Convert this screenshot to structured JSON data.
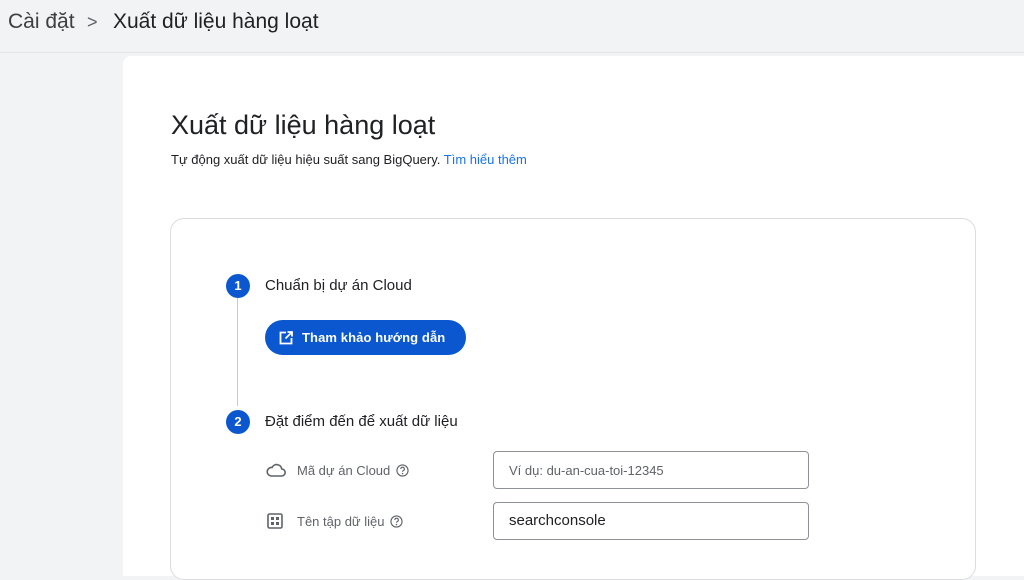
{
  "breadcrumb": {
    "root": "Cài đặt",
    "separator": ">",
    "current": "Xuất dữ liệu hàng loạt"
  },
  "page": {
    "title": "Xuất dữ liệu hàng loạt",
    "description": "Tự động xuất dữ liệu hiệu suất sang BigQuery.",
    "learn_more": "Tìm hiểu thêm"
  },
  "steps": [
    {
      "number": "1",
      "title": "Chuẩn bị dự án Cloud",
      "button_label": "Tham khảo hướng dẫn",
      "button_icon": "open-in-new-icon"
    },
    {
      "number": "2",
      "title": "Đặt điểm đến để xuất dữ liệu",
      "fields": [
        {
          "label": "Mã dự án Cloud",
          "icon": "cloud-icon",
          "placeholder": "Ví dụ: du-an-cua-toi-12345",
          "value": ""
        },
        {
          "label": "Tên tập dữ liệu",
          "icon": "dataset-grid-icon",
          "placeholder": "",
          "value": "searchconsole"
        }
      ]
    }
  ],
  "colors": {
    "accent": "#0b57d0",
    "link": "#1a73e8",
    "background": "#f1f3f4"
  }
}
